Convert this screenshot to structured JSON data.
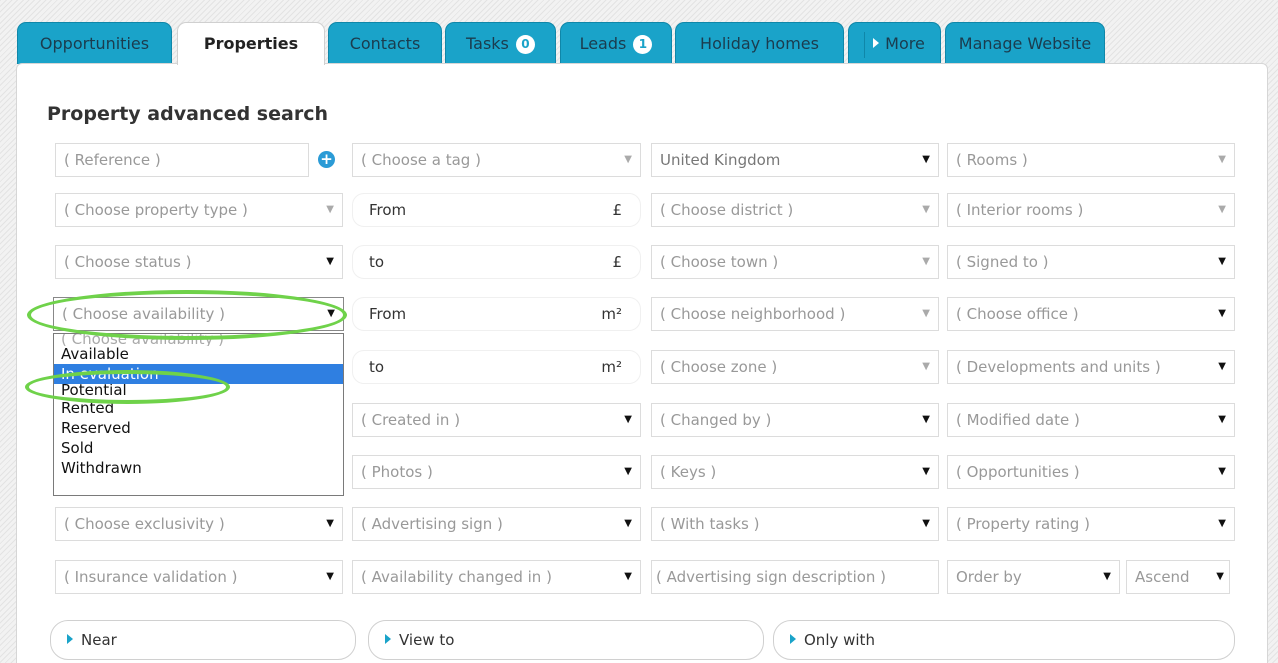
{
  "tabs": [
    {
      "label": "Opportunities"
    },
    {
      "label": "Properties"
    },
    {
      "label": "Contacts"
    },
    {
      "label": "Tasks",
      "badge": "0"
    },
    {
      "label": "Leads",
      "badge": "1"
    },
    {
      "label": "Holiday homes"
    },
    {
      "label": "More"
    },
    {
      "label": "Manage Website"
    }
  ],
  "search": {
    "title": "Property advanced search",
    "reference": "( Reference )",
    "tag": "( Choose a tag )",
    "country": "United Kingdom",
    "rooms": "( Rooms )",
    "property_type": "( Choose property type )",
    "price_from": "From",
    "price_from_unit": "£",
    "district": "( Choose district )",
    "interior_rooms": "( Interior rooms )",
    "status": "( Choose status )",
    "price_to": "to",
    "price_to_unit": "£",
    "town": "( Choose town )",
    "signed_to": "( Signed to )",
    "availability": "( Choose availability )",
    "area_from": "From",
    "area_from_unit": "m²",
    "neighborhood": "( Choose neighborhood )",
    "office": "( Choose office )",
    "area_to": "to",
    "area_to_unit": "m²",
    "zone": "( Choose zone )",
    "developments": "( Developments and units )",
    "created_in": "( Created in )",
    "changed_by": "( Changed by )",
    "modified_date": "( Modified date )",
    "photos": "( Photos )",
    "keys": "( Keys )",
    "opportunities": "( Opportunities )",
    "exclusivity": "( Choose exclusivity )",
    "advertising_sign": "( Advertising sign )",
    "with_tasks": "( With tasks )",
    "property_rating": "( Property rating )",
    "insurance": "( Insurance validation )",
    "availability_changed": "( Availability changed in )",
    "advertising_desc": "( Advertising sign description )",
    "order_by": "Order by",
    "order_dir": "Ascend"
  },
  "availability_options": [
    "( Choose availability )",
    "Available",
    "In evaluation",
    "Potential",
    "Rented",
    "Reserved",
    "Sold",
    "Withdrawn"
  ],
  "bottom": {
    "near": "Near",
    "view_to": "View to",
    "only_with": "Only with"
  },
  "colors": {
    "tab_accent": "#1aa3c9",
    "selection": "#2f7fe1",
    "annotation": "#6fd24a",
    "plus_icon": "#2b9bd6"
  }
}
